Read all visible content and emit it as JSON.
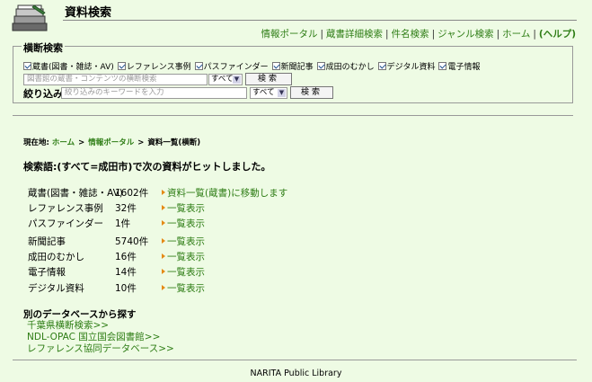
{
  "header": {
    "title": "資料検索",
    "nav": [
      {
        "label": "情報ポータル"
      },
      {
        "label": "蔵書詳細検索"
      },
      {
        "label": "件名検索"
      },
      {
        "label": "ジャンル検索"
      },
      {
        "label": "ホーム"
      },
      {
        "label": "(ヘルプ)"
      }
    ]
  },
  "search": {
    "legend": "横断検索",
    "checkboxes": [
      {
        "label": "蔵書(図書・雑誌・AV)",
        "checked": true
      },
      {
        "label": "レファレンス事例",
        "checked": true
      },
      {
        "label": "パスファインダー",
        "checked": true
      },
      {
        "label": "新聞記事",
        "checked": true
      },
      {
        "label": "成田のむかし",
        "checked": true
      },
      {
        "label": "デジタル資料",
        "checked": true
      },
      {
        "label": "電子情報",
        "checked": true
      }
    ],
    "main_placeholder": "図書館の蔵書・コンテンツの横断検索",
    "main_select": "すべて",
    "search_button": "検索",
    "narrow_label": "絞り込み",
    "narrow_placeholder": "絞り込みのキーワードを入力",
    "narrow_select": "すべて",
    "narrow_button": "検索"
  },
  "breadcrumb": {
    "prefix": "現在地:",
    "home": "ホーム",
    "portal": "情報ポータル",
    "current": "資料一覧(横断)"
  },
  "result_heading": "検索語:(すべて=成田市)で次の資料がヒットしました。",
  "results": [
    {
      "label": "蔵書(図書・雑誌・AV)",
      "count": "1602件",
      "link": "資料一覧(蔵書)に移動します"
    },
    {
      "label": "レファレンス事例",
      "count": "32件",
      "link": "一覧表示"
    },
    {
      "label": "パスファインダー",
      "count": "1件",
      "link": "一覧表示"
    },
    {
      "label": "新聞記事",
      "count": "5740件",
      "link": "一覧表示"
    },
    {
      "label": "成田のむかし",
      "count": "16件",
      "link": "一覧表示"
    },
    {
      "label": "電子情報",
      "count": "14件",
      "link": "一覧表示"
    },
    {
      "label": "デジタル資料",
      "count": "10件",
      "link": "一覧表示"
    }
  ],
  "other_db": {
    "heading": "別のデータベースから探す",
    "links": [
      {
        "label": "千葉県横断検索>>"
      },
      {
        "label": "NDL-OPAC 国立国会図書館>>"
      },
      {
        "label": "レファレンス協同データベース>>"
      }
    ]
  },
  "footer": "NARITA Public Library",
  "colors": {
    "background": "#eefbe4",
    "link": "#2e7d15",
    "arrow": "#e58a16"
  }
}
